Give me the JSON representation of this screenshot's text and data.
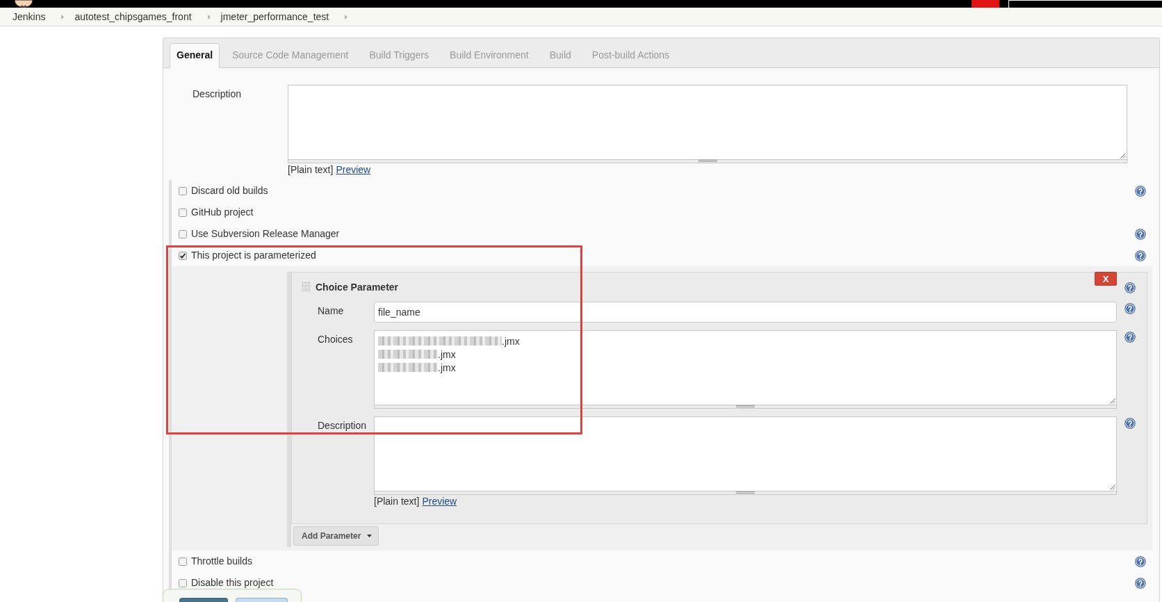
{
  "breadcrumbs": [
    "Jenkins",
    "autotest_chipsgames_front",
    "jmeter_performance_test"
  ],
  "tabs": [
    {
      "label": "General",
      "selected": true
    },
    {
      "label": "Source Code Management",
      "selected": false
    },
    {
      "label": "Build Triggers",
      "selected": false
    },
    {
      "label": "Build Environment",
      "selected": false
    },
    {
      "label": "Build",
      "selected": false
    },
    {
      "label": "Post-build Actions",
      "selected": false
    }
  ],
  "description": {
    "label": "Description",
    "format_note": "[Plain text]",
    "preview_link": "Preview"
  },
  "general_options": [
    {
      "label": "Discard old builds",
      "checked": false,
      "help": true
    },
    {
      "label": "GitHub project",
      "checked": false,
      "help": false
    },
    {
      "label": "Use Subversion Release Manager",
      "checked": false,
      "help": true
    },
    {
      "label": "This project is parameterized",
      "checked": true,
      "help": true,
      "parameters": [
        {
          "title": "Choice Parameter",
          "delete_label": "X",
          "help": true,
          "fields": [
            {
              "kind": "text",
              "label": "Name",
              "value": "file_name",
              "help": true
            },
            {
              "kind": "lines",
              "label": "Choices",
              "help": true,
              "lines": [
                {
                  "blurred": true,
                  "text": ".jmx"
                },
                {
                  "blurred": true,
                  "text": ".jmx"
                },
                {
                  "blurred": true,
                  "text": ".jmx"
                }
              ]
            },
            {
              "kind": "textarea",
              "label": "Description",
              "help": true,
              "format_note": "[Plain text]",
              "preview_link": "Preview"
            }
          ]
        }
      ],
      "add_button": "Add Parameter"
    }
  ],
  "more_options": [
    {
      "label": "Throttle builds",
      "checked": false,
      "help": true
    },
    {
      "label": "Disable this project",
      "checked": false,
      "help": true
    }
  ],
  "bottom_bar": {
    "buttons": [
      {
        "kind": "primary"
      },
      {
        "kind": "secondary"
      }
    ]
  },
  "highlight_box": true
}
